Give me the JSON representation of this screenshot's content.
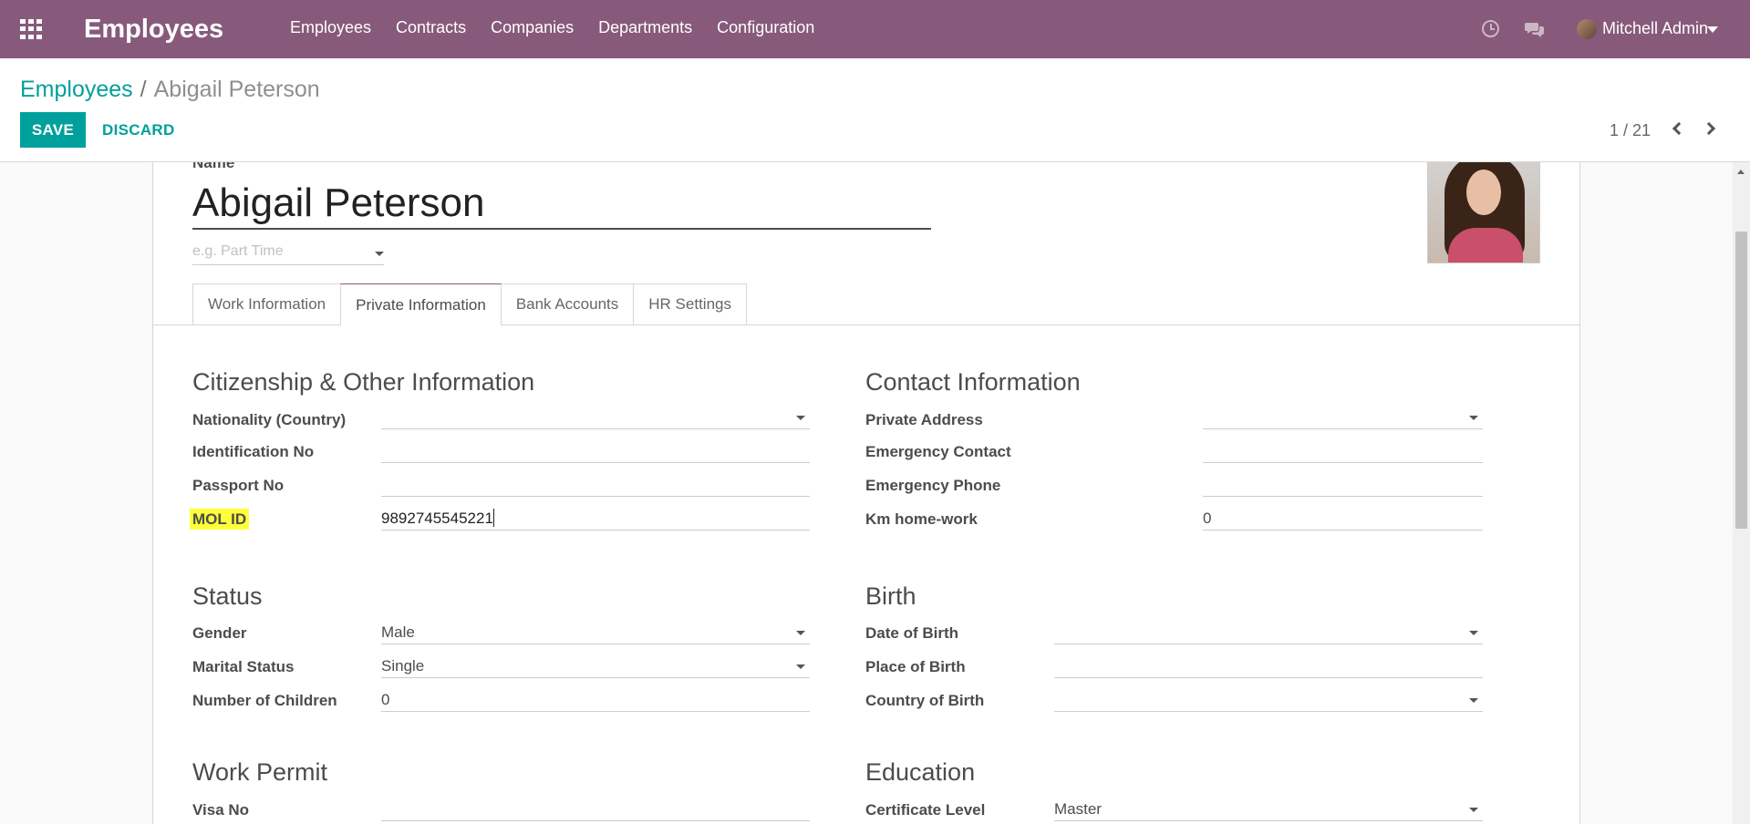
{
  "navbar": {
    "app_title": "Employees",
    "menu": [
      "Employees",
      "Contracts",
      "Companies",
      "Departments",
      "Configuration"
    ],
    "user_name": "Mitchell Admin"
  },
  "control_panel": {
    "breadcrumb_parent": "Employees",
    "breadcrumb_separator": "/",
    "breadcrumb_current": "Abigail Peterson",
    "save_label": "SAVE",
    "discard_label": "DISCARD",
    "pager": "1 / 21"
  },
  "form": {
    "name_label": "Name",
    "name_value": "Abigail Peterson",
    "job_placeholder": "e.g. Part Time",
    "tabs": [
      "Work Information",
      "Private Information",
      "Bank Accounts",
      "HR Settings"
    ],
    "active_tab": "Private Information",
    "citizenship": {
      "title": "Citizenship & Other Information",
      "fields": [
        {
          "label": "Nationality (Country)",
          "value": ""
        },
        {
          "label": "Identification No",
          "value": ""
        },
        {
          "label": "Passport No",
          "value": ""
        },
        {
          "label": "MOL ID",
          "value": "9892745545221"
        }
      ]
    },
    "contact": {
      "title": "Contact Information",
      "fields": [
        {
          "label": "Private Address",
          "value": ""
        },
        {
          "label": "Emergency Contact",
          "value": ""
        },
        {
          "label": "Emergency Phone",
          "value": ""
        },
        {
          "label": "Km home-work",
          "value": "0"
        }
      ]
    },
    "status": {
      "title": "Status",
      "fields": [
        {
          "label": "Gender",
          "value": "Male"
        },
        {
          "label": "Marital Status",
          "value": "Single"
        },
        {
          "label": "Number of Children",
          "value": "0"
        }
      ]
    },
    "birth": {
      "title": "Birth",
      "fields": [
        {
          "label": "Date of Birth",
          "value": ""
        },
        {
          "label": "Place of Birth",
          "value": ""
        },
        {
          "label": "Country of Birth",
          "value": ""
        }
      ]
    },
    "work_permit": {
      "title": "Work Permit",
      "fields": [
        {
          "label": "Visa No",
          "value": ""
        }
      ]
    },
    "education": {
      "title": "Education",
      "fields": [
        {
          "label": "Certificate Level",
          "value": "Master"
        }
      ]
    }
  },
  "colors": {
    "navbar": "#875a7b",
    "primary": "#00a09d",
    "highlight": "#ffff3b"
  }
}
